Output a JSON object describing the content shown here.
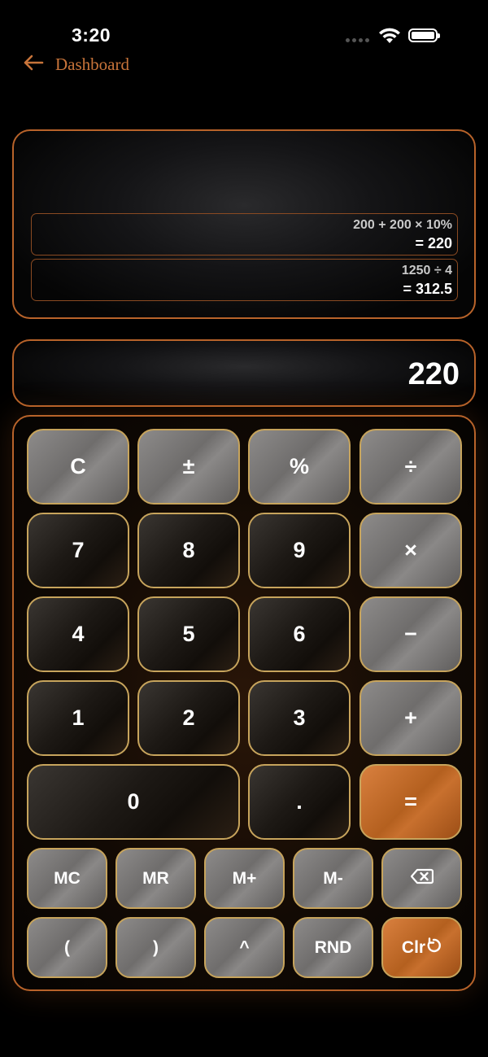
{
  "status": {
    "time": "3:20"
  },
  "nav": {
    "back_label": "Dashboard"
  },
  "history": [
    {
      "expression": "200 + 200 × 10%",
      "result": "= 220"
    },
    {
      "expression": "1250 ÷ 4",
      "result": "= 312.5"
    }
  ],
  "display": {
    "value": "220"
  },
  "keys": {
    "clear": "C",
    "plus_minus": "±",
    "percent": "%",
    "divide": "÷",
    "seven": "7",
    "eight": "8",
    "nine": "9",
    "multiply": "×",
    "four": "4",
    "five": "5",
    "six": "6",
    "minus": "−",
    "one": "1",
    "two": "2",
    "three": "3",
    "plus": "+",
    "zero": "0",
    "decimal": ".",
    "equals": "=",
    "mc": "MC",
    "mr": "MR",
    "m_plus": "M+",
    "m_minus": "M-",
    "open_paren": "(",
    "close_paren": ")",
    "power": "^",
    "round": "RND",
    "clear_all": "Clr"
  },
  "colors": {
    "accent": "#b8632a",
    "key_border": "#c7a45c",
    "orange_key": "#c8702e",
    "gray_key": "#7d7b7a",
    "dark_key": "#1d1915"
  },
  "icons": {
    "back": "arrow-left-icon",
    "backspace": "backspace-icon",
    "clr_refresh": "refresh-icon",
    "wifi": "wifi-icon",
    "battery": "battery-icon"
  }
}
